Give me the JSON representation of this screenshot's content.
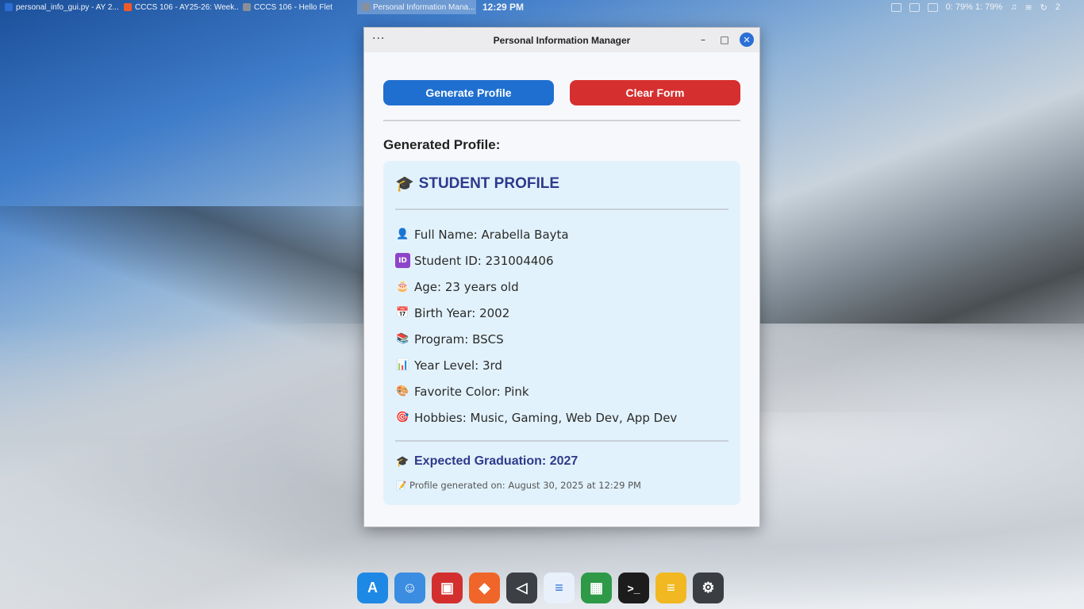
{
  "taskbar": {
    "tasks": [
      {
        "label": "personal_info_gui.py - AY 2...",
        "color": "#2b6fd6"
      },
      {
        "label": "CCCS 106 - AY25-26: Week...",
        "color": "#f05a28"
      },
      {
        "label": "CCCS 106 - Hello Flet",
        "color": "#8a8f99"
      },
      {
        "label": "Personal Information Mana...",
        "color": "#8a8f99"
      }
    ],
    "clock": "12:29 PM",
    "battery_text": "0: 79%  1: 79%",
    "notifications": "2"
  },
  "window": {
    "title": "Personal Information Manager",
    "menu_glyph": "···",
    "min_glyph": "–",
    "max_glyph": "□",
    "close_glyph": "✕"
  },
  "actions": {
    "generate_label": "Generate Profile",
    "clear_label": "Clear Form"
  },
  "section_label": "Generated Profile:",
  "profile": {
    "title": "STUDENT PROFILE",
    "title_icon": "🎓",
    "fields": [
      {
        "icon": "👤",
        "icon_name": "person-icon",
        "text": "Full Name: Arabella Bayta"
      },
      {
        "icon": "ID",
        "icon_name": "id-icon",
        "text": "Student ID: 231004406"
      },
      {
        "icon": "🎂",
        "icon_name": "cake-icon",
        "text": "Age: 23 years old"
      },
      {
        "icon": "📅",
        "icon_name": "calendar-icon",
        "text": "Birth Year: 2002"
      },
      {
        "icon": "📚",
        "icon_name": "books-icon",
        "text": "Program: BSCS"
      },
      {
        "icon": "📊",
        "icon_name": "chart-icon",
        "text": "Year Level: 3rd"
      },
      {
        "icon": "🎨",
        "icon_name": "palette-icon",
        "text": "Favorite Color: Pink"
      },
      {
        "icon": "🎯",
        "icon_name": "target-icon",
        "text": "Hobbies: Music, Gaming, Web Dev, App Dev"
      }
    ],
    "graduation_icon": "🎓",
    "graduation": "Expected Graduation: 2027",
    "generated_icon": "📝",
    "generated_on": "Profile generated on: August 30, 2025 at 12:29 PM"
  },
  "dock": [
    {
      "name": "dock-appstore-icon",
      "glyph": "A",
      "color": "#1e88e5"
    },
    {
      "name": "dock-finder-icon",
      "glyph": "☺",
      "color": "#3a8de0"
    },
    {
      "name": "dock-photo-icon",
      "glyph": "▣",
      "color": "#d32f2f"
    },
    {
      "name": "dock-brave-icon",
      "glyph": "◆",
      "color": "#f06529"
    },
    {
      "name": "dock-vscode-icon",
      "glyph": "◁",
      "color": "#3c3f44"
    },
    {
      "name": "dock-docs-icon",
      "glyph": "≡",
      "color": "#e8f0fb"
    },
    {
      "name": "dock-sheets-icon",
      "glyph": "▦",
      "color": "#2e9a47"
    },
    {
      "name": "dock-terminal-icon",
      "glyph": ">_",
      "color": "#1c1c1c"
    },
    {
      "name": "dock-notes-icon",
      "glyph": "≡",
      "color": "#f2b821"
    },
    {
      "name": "dock-settings-icon",
      "glyph": "⚙",
      "color": "#3a3d42"
    }
  ],
  "colors": {
    "generate_button": "#1f6fd0",
    "clear_button": "#d62f2f",
    "profile_title": "#2d3a8c",
    "card_bg": "#e2f2fc"
  }
}
